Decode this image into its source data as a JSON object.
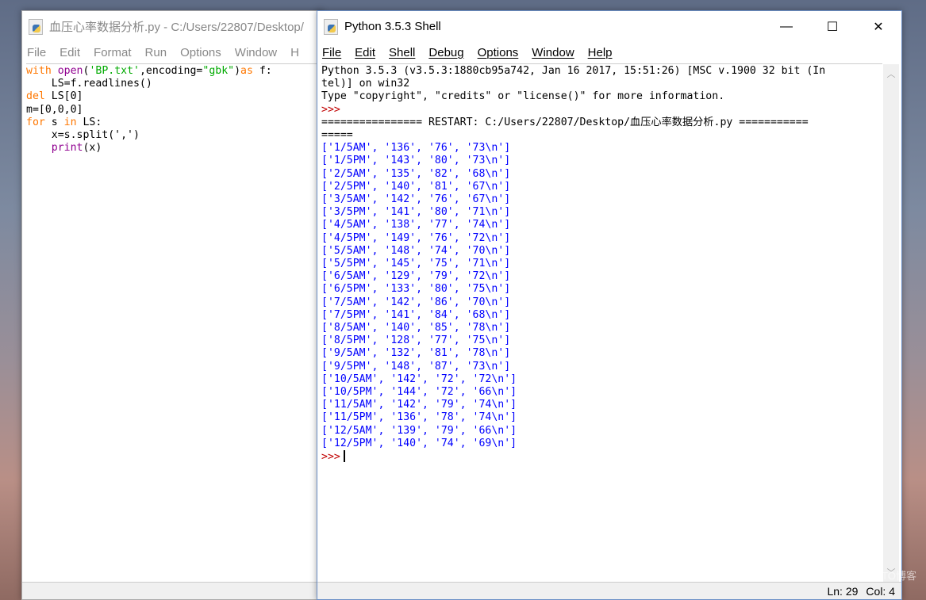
{
  "editor": {
    "title": "血压心率数据分析.py - C:/Users/22807/Desktop/",
    "menu": [
      "File",
      "Edit",
      "Format",
      "Run",
      "Options",
      "Window",
      "H"
    ]
  },
  "shell": {
    "title": "Python 3.5.3 Shell",
    "menu": [
      "File",
      "Edit",
      "Shell",
      "Debug",
      "Options",
      "Window",
      "Help"
    ],
    "banner": [
      "Python 3.5.3 (v3.5.3:1880cb95a742, Jan 16 2017, 15:51:26) [MSC v.1900 32 bit (In",
      "tel)] on win32",
      "Type \"copyright\", \"credits\" or \"license()\" for more information."
    ],
    "prompt": ">>>",
    "restart": [
      "================ RESTART: C:/Users/22807/Desktop/血压心率数据分析.py ===========",
      "====="
    ],
    "rows": [
      [
        "1/5AM",
        "136",
        "76",
        "73"
      ],
      [
        "1/5PM",
        "143",
        "80",
        "73"
      ],
      [
        "2/5AM",
        "135",
        "82",
        "68"
      ],
      [
        "2/5PM",
        "140",
        "81",
        "67"
      ],
      [
        "3/5AM",
        "142",
        "76",
        "67"
      ],
      [
        "3/5PM",
        "141",
        "80",
        "71"
      ],
      [
        "4/5AM",
        "138",
        "77",
        "74"
      ],
      [
        "4/5PM",
        "149",
        "76",
        "72"
      ],
      [
        "5/5AM",
        "148",
        "74",
        "70"
      ],
      [
        "5/5PM",
        "145",
        "75",
        "71"
      ],
      [
        "6/5AM",
        "129",
        "79",
        "72"
      ],
      [
        "6/5PM",
        "133",
        "80",
        "75"
      ],
      [
        "7/5AM",
        "142",
        "86",
        "70"
      ],
      [
        "7/5PM",
        "141",
        "84",
        "68"
      ],
      [
        "8/5AM",
        "140",
        "85",
        "78"
      ],
      [
        "8/5PM",
        "128",
        "77",
        "75"
      ],
      [
        "9/5AM",
        "132",
        "81",
        "78"
      ],
      [
        "9/5PM",
        "148",
        "87",
        "73"
      ],
      [
        "10/5AM",
        "142",
        "72",
        "72"
      ],
      [
        "10/5PM",
        "144",
        "72",
        "66"
      ],
      [
        "11/5AM",
        "142",
        "79",
        "74"
      ],
      [
        "11/5PM",
        "136",
        "78",
        "74"
      ],
      [
        "12/5AM",
        "139",
        "79",
        "66"
      ],
      [
        "12/5PM",
        "140",
        "74",
        "69"
      ]
    ],
    "status": {
      "ln": "Ln: 29",
      "col": "Col: 4"
    },
    "controls": {
      "minimize": "—",
      "maximize": "☐",
      "close": "✕"
    }
  },
  "watermark": "@51CTO博客"
}
